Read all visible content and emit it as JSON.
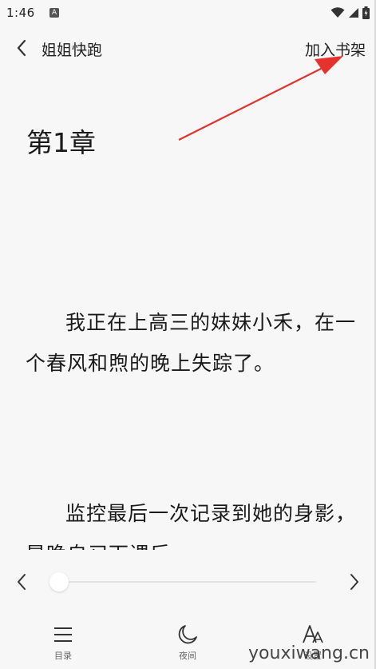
{
  "status_bar": {
    "time": "1:46",
    "notification_icon": "A"
  },
  "header": {
    "title": "姐姐快跑",
    "add_shelf_label": "加入书架"
  },
  "chapter": {
    "title": "第1章",
    "paragraphs": [
      "我正在上高三的妹妹小禾，在一个春风和煦的晚上失踪了。",
      "监控最后一次记录到她的身影，是晚自习下课后。"
    ]
  },
  "reader": {
    "progress_fraction": 0.0
  },
  "bottom_nav": {
    "toc_label": "目录",
    "night_label": "夜间",
    "settings_label": "设置"
  },
  "watermark": "youxiwang.cn",
  "colors": {
    "background": "#f7f7f7",
    "annotation_arrow": "#e5322d",
    "text": "#1a1a1a"
  }
}
